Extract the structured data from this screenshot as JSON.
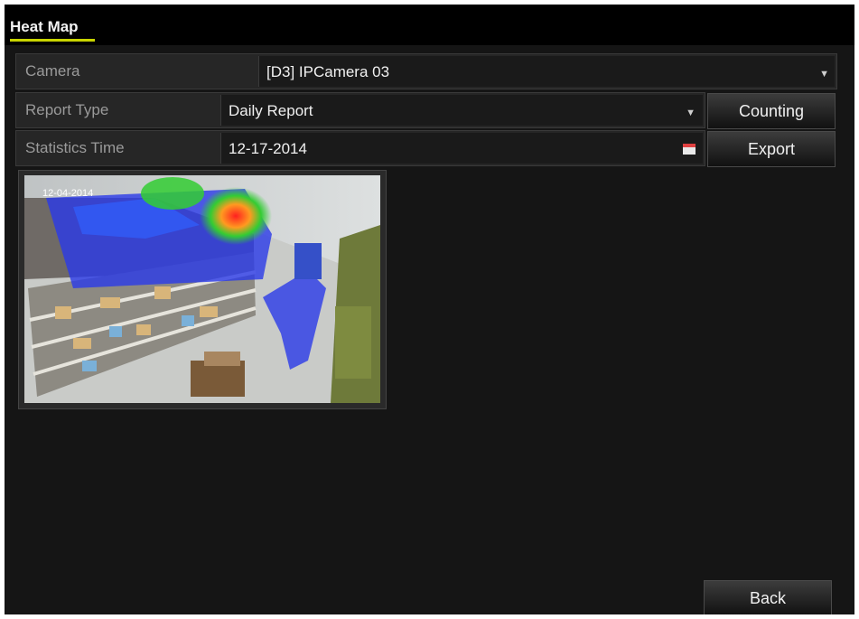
{
  "title": "Heat Map",
  "colors": {
    "accent": "#c8d400",
    "panel": "#151515",
    "titlebar": "#000000"
  },
  "camera": {
    "label": "Camera",
    "value": "[D3] IPCamera 03"
  },
  "report_type": {
    "label": "Report Type",
    "value": "Daily Report"
  },
  "statistics_time": {
    "label": "Statistics Time",
    "value": "12-17-2014"
  },
  "buttons": {
    "counting": "Counting",
    "export": "Export",
    "back": "Back"
  },
  "preview": {
    "osd_date": "12-04-2014"
  },
  "icons": {
    "dropdown": "chevron-down-icon",
    "date": "calendar-icon"
  }
}
